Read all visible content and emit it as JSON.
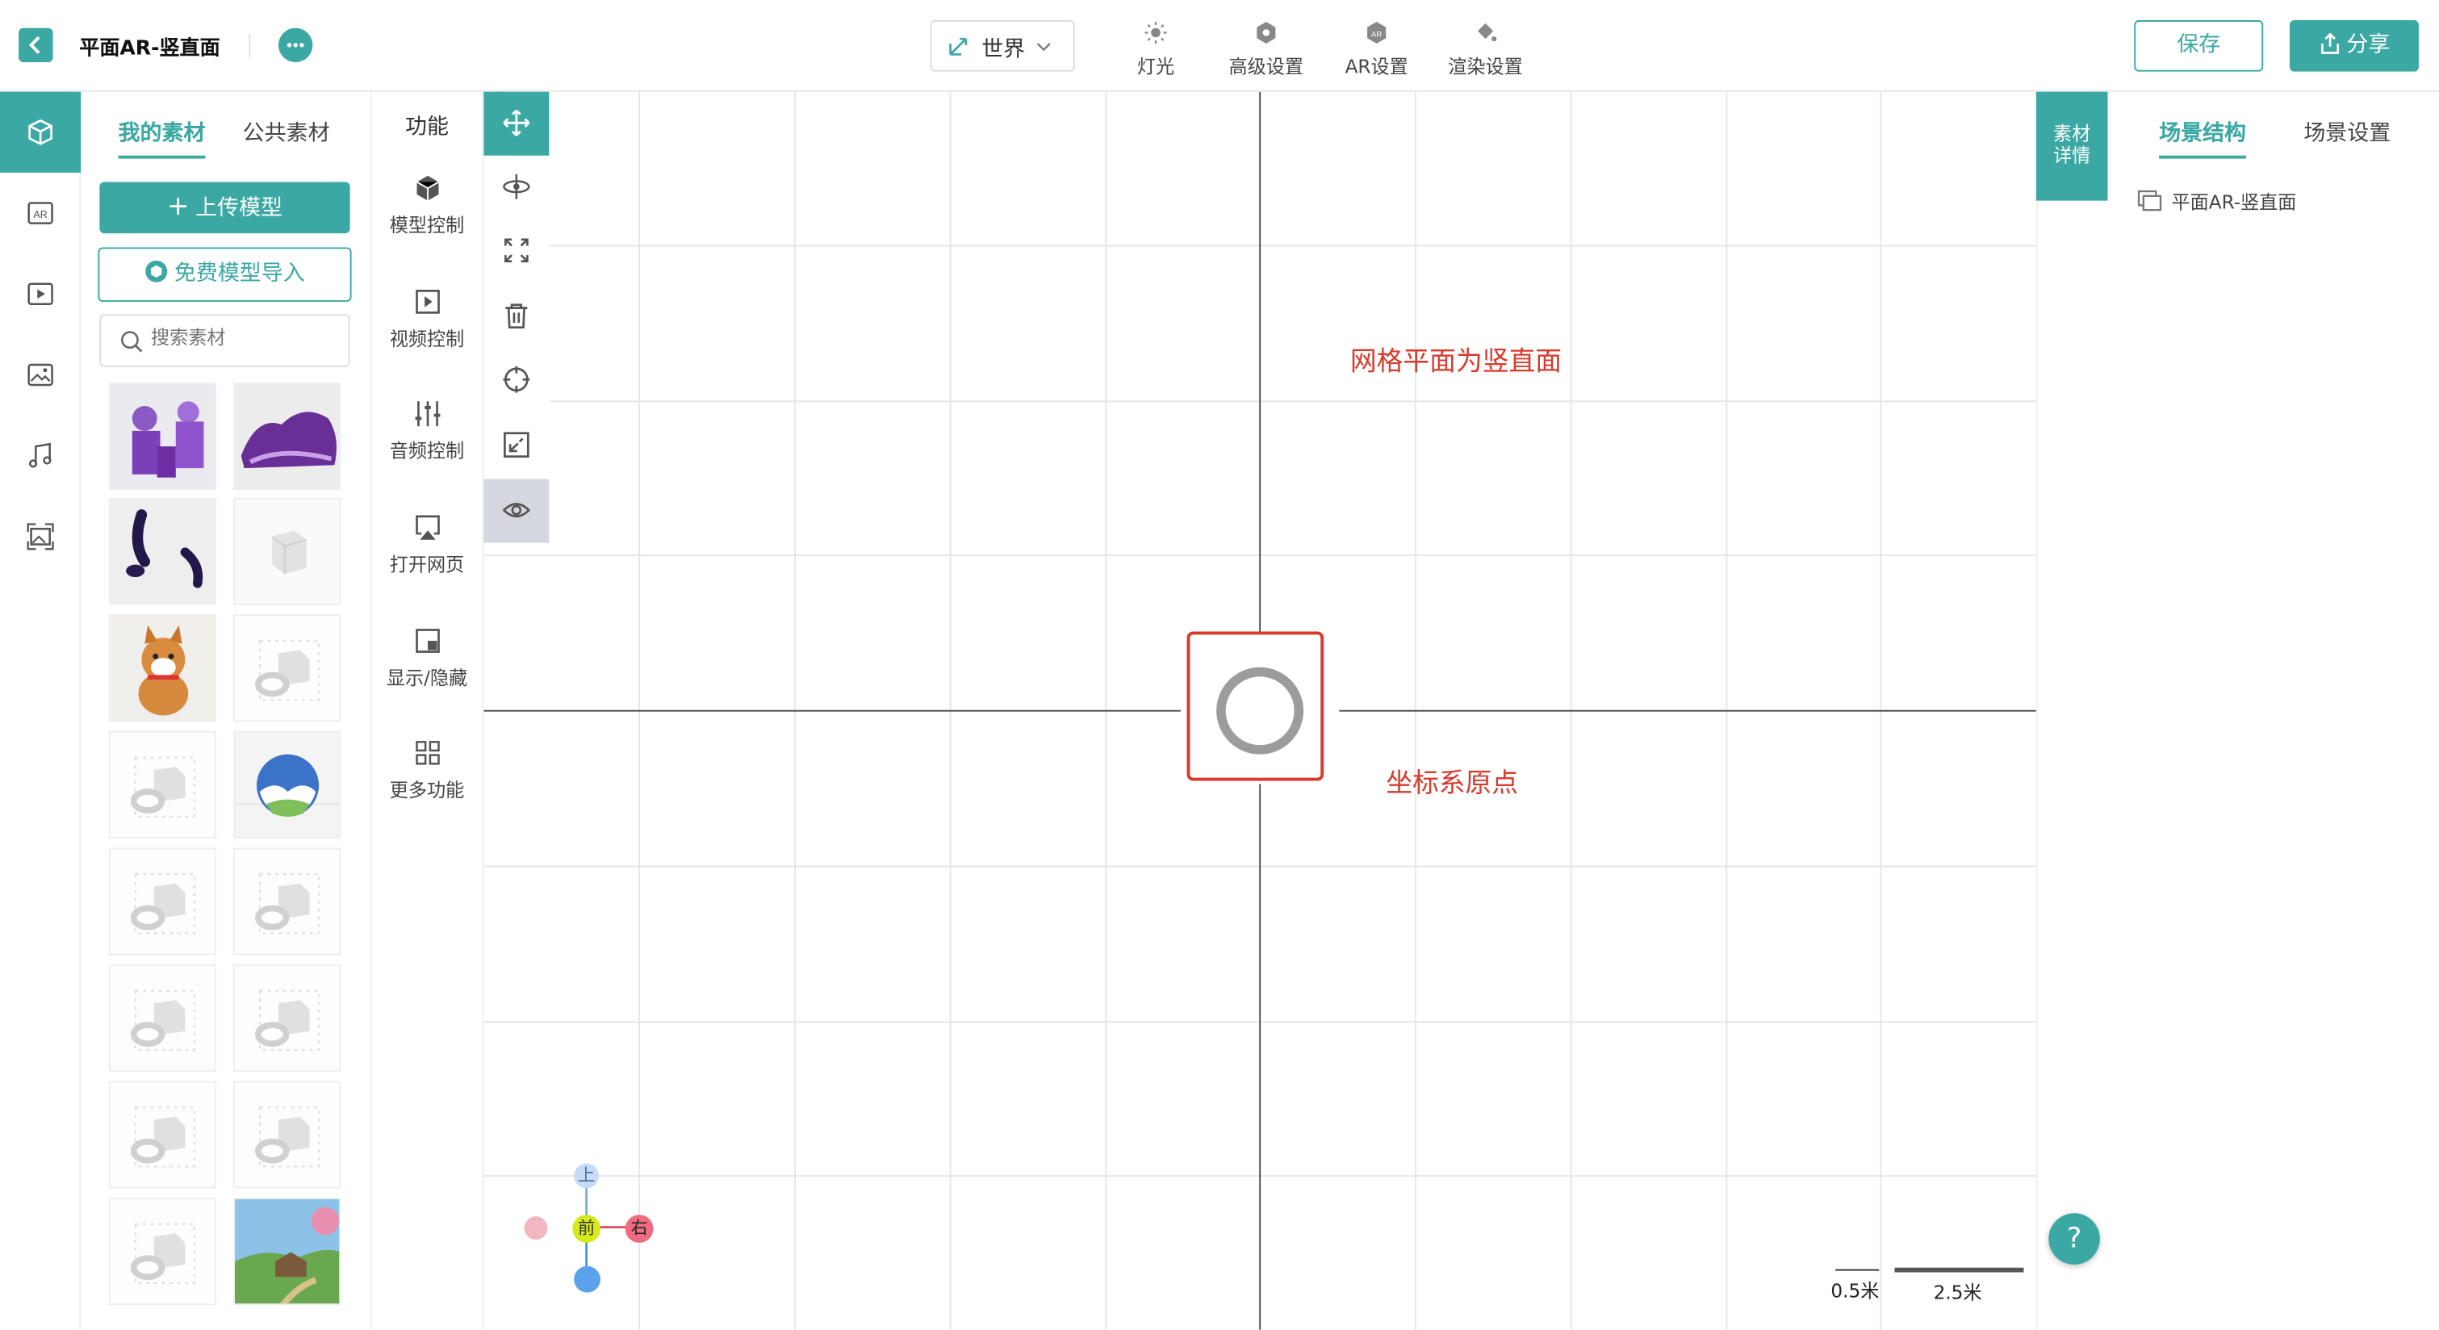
{
  "header": {
    "title": "平面AR-竖直面",
    "coord_mode": "世界",
    "tools": [
      {
        "label": "灯光",
        "icon": "sun-icon"
      },
      {
        "label": "高级设置",
        "icon": "gear-icon"
      },
      {
        "label": "AR设置",
        "icon": "ar-hex-icon"
      },
      {
        "label": "渲染设置",
        "icon": "paint-bucket-icon"
      }
    ],
    "save_label": "保存",
    "share_label": "分享"
  },
  "left_rail": {
    "items": [
      {
        "icon": "cube-icon",
        "active": true
      },
      {
        "icon": "ar-icon",
        "label": "AR"
      },
      {
        "icon": "video-icon"
      },
      {
        "icon": "image-icon"
      },
      {
        "icon": "music-icon"
      },
      {
        "icon": "panorama-icon"
      }
    ]
  },
  "materials": {
    "tabs": [
      {
        "label": "我的素材",
        "active": true
      },
      {
        "label": "公共素材",
        "active": false
      }
    ],
    "upload_label": "上传模型",
    "import_label": "免费模型导入",
    "search_placeholder": "搜索素材",
    "thumbnails": [
      "purple-figures",
      "purple-landscape",
      "dark-curves",
      "white-cube",
      "shiba-dog",
      "placeholder",
      "placeholder",
      "sky-sphere",
      "placeholder",
      "placeholder",
      "placeholder",
      "placeholder",
      "placeholder",
      "placeholder",
      "placeholder",
      "cartoon-landscape"
    ]
  },
  "functions": {
    "title": "功能",
    "items": [
      {
        "label": "模型控制",
        "icon": "hexagon-icon"
      },
      {
        "label": "视频控制",
        "icon": "play-box-icon"
      },
      {
        "label": "音频控制",
        "icon": "sliders-icon"
      },
      {
        "label": "打开网页",
        "icon": "airplay-icon"
      },
      {
        "label": "显示/隐藏",
        "icon": "picture-in-picture-icon"
      },
      {
        "label": "更多功能",
        "icon": "grid-icon"
      }
    ]
  },
  "toolstrip": [
    "move-icon",
    "rotate-icon",
    "expand-icon",
    "trash-icon",
    "crosshair-icon",
    "shrink-icon",
    "eye-icon"
  ],
  "canvas": {
    "note_plane": "网格平面为竖直面",
    "note_origin": "坐标系原点",
    "gizmo": {
      "up": "上",
      "front": "前",
      "right": "右"
    },
    "scale_small": "0.5米",
    "scale_large": "2.5米",
    "accent_red": "#d8392b"
  },
  "right_panel": {
    "detail_label_1": "素材",
    "detail_label_2": "详情",
    "tabs": [
      {
        "label": "场景结构",
        "active": true
      },
      {
        "label": "场景设置",
        "active": false
      }
    ],
    "tree_item": "平面AR-竖直面",
    "help": "?"
  },
  "colors": {
    "accent": "#3ba8a4",
    "note": "#d8392b"
  }
}
